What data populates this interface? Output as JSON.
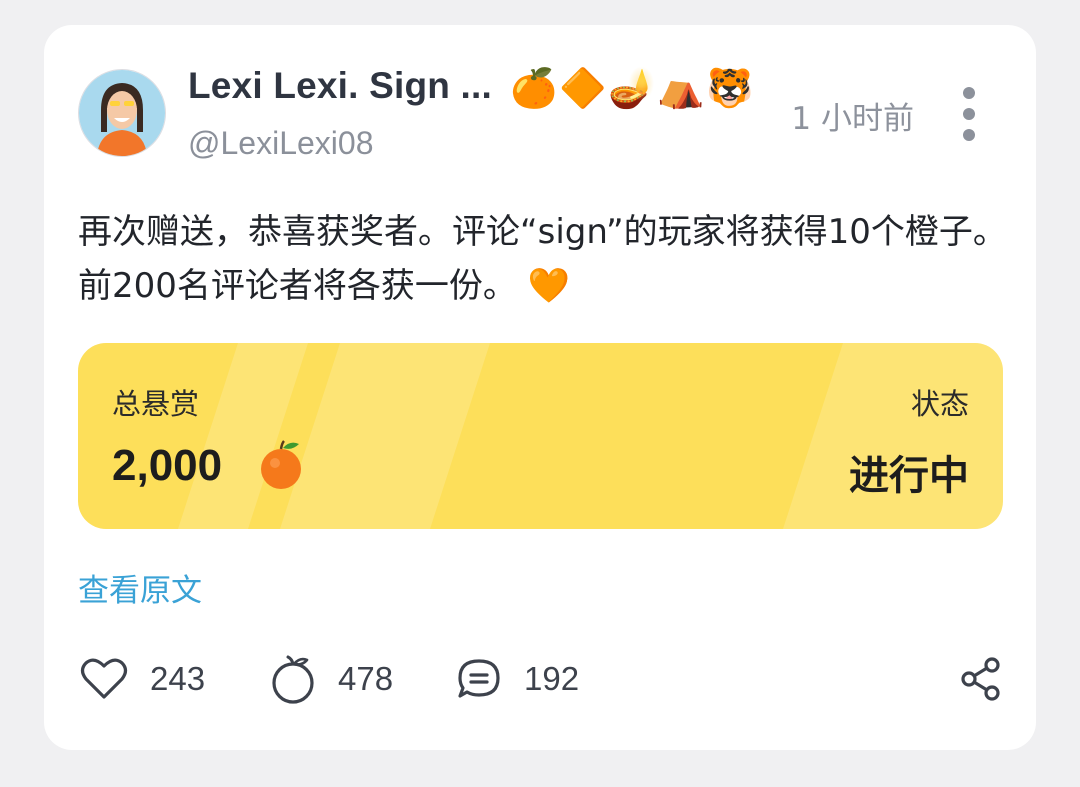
{
  "author": {
    "display_name": "Lexi Lexi. Sign ...",
    "name_emojis": [
      "🍊",
      "🔶",
      "🪔",
      "⛺",
      "🐯"
    ],
    "handle": "@LexiLexi08"
  },
  "post": {
    "time": "1 小时前",
    "text": "再次赠送，恭喜获奖者。评论“sign”的玩家将获得10个橙子。前200名评论者将各获一份。",
    "text_emoji": "🧡"
  },
  "reward": {
    "total_label": "总悬赏",
    "total_value": "2,000",
    "status_label": "状态",
    "status_value": "进行中"
  },
  "view_original": "查看原文",
  "actions": {
    "likes": "243",
    "oranges": "478",
    "comments": "192"
  },
  "colors": {
    "reward_bg": "#fddf5a",
    "link": "#3aa2d6",
    "heart_emoji": "#f5941d"
  },
  "icons": {
    "more": "more-vertical-icon",
    "like": "heart-icon",
    "orange": "orange-icon",
    "comment": "comment-icon",
    "share": "share-icon",
    "reward": "tangerine-icon"
  }
}
